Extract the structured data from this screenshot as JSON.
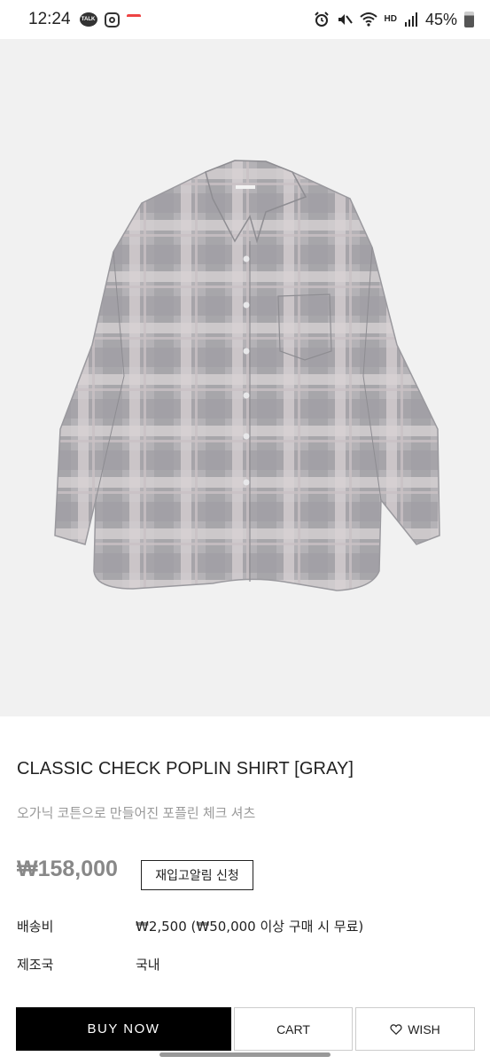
{
  "status_bar": {
    "time": "12:24",
    "talk_icon_text": "TALK",
    "hd_label": "HD",
    "battery": "45%"
  },
  "product": {
    "title": "CLASSIC CHECK POPLIN SHIRT [GRAY]",
    "subtitle": "오가닉 코튼으로 만들어진 포플린 체크 셔츠",
    "price": "₩158,000",
    "restock_label": "재입고알림 신청",
    "shipping_label": "배송비",
    "shipping_value": "₩2,500 (₩50,000 이상 구매 시 무료)",
    "origin_label": "제조국",
    "origin_value": "국내"
  },
  "actions": {
    "buy_now": "BUY NOW",
    "cart": "CART",
    "wish": "WISH"
  },
  "colors": {
    "image_background": "#f1f1f1",
    "buy_button": "#000000",
    "price_text": "#888888"
  }
}
